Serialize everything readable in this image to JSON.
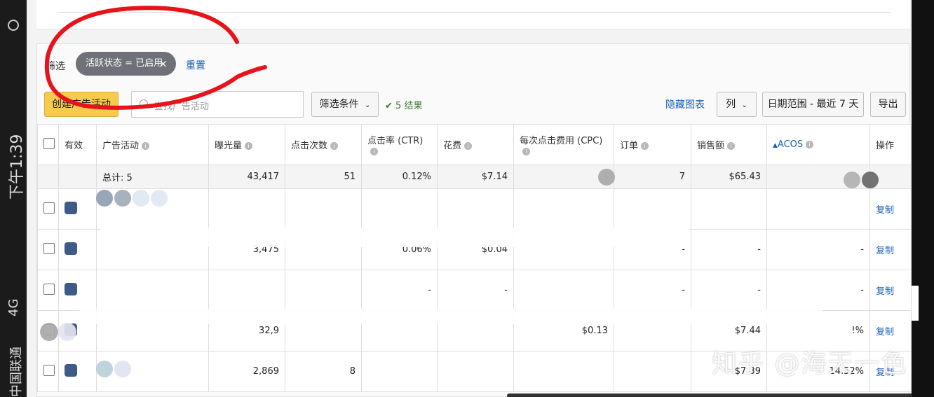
{
  "status_bar": {
    "time": "下午1:39",
    "network": "4G",
    "carrier": "中国联通"
  },
  "filter": {
    "label": "筛选",
    "chip": "活跃状态 = 已启用",
    "chip_close": "×",
    "reset": "重置"
  },
  "toolbar": {
    "create": "创建广告活动",
    "search_placeholder": "查找广告活动",
    "filter_conditions": "筛选条件",
    "results": "5 结果",
    "hide_chart": "隐藏图表",
    "columns": "列",
    "date_range": "日期范围 - 最近 7 天",
    "export": "导出"
  },
  "table": {
    "headers": [
      "有效",
      "广告活动",
      "曝光量",
      "点击次数",
      "点击率 (CTR)",
      "花费",
      "每次点击费用 (CPC)",
      "订单",
      "销售额",
      "ACOS",
      "操作"
    ],
    "total": {
      "label": "总计: 5",
      "impressions": "43,417",
      "clicks": "51",
      "ctr": "0.12%",
      "spend": "$7.14",
      "orders": "7",
      "sales": "$65.43"
    },
    "rows": [
      {
        "impressions": "",
        "clicks": "",
        "ctr": "",
        "spend": "",
        "cpc": "",
        "orders": "",
        "sales": "",
        "acos": "",
        "action": "复制"
      },
      {
        "impressions": "3,475",
        "clicks": "",
        "ctr": "0.06%",
        "spend": "$0.04",
        "cpc": "",
        "orders": "-",
        "sales": "-",
        "acos": "-",
        "action": "复制"
      },
      {
        "impressions": "",
        "clicks": "",
        "ctr": "-",
        "spend": "-",
        "cpc": "",
        "orders": "-",
        "sales": "-",
        "acos": "-",
        "action": "复制"
      },
      {
        "impressions": "32,9",
        "clicks": "",
        "ctr": "",
        "spend": "",
        "cpc": "$0.13",
        "orders": "",
        "sales": "$7.44",
        "acos": "!%",
        "action": "复制"
      },
      {
        "impressions": "2,869",
        "clicks": "8",
        "ctr": "",
        "spend": "",
        "cpc": "",
        "orders": "",
        "sales": "$7.39",
        "acos": "14.52%",
        "action": "复制"
      }
    ]
  },
  "watermark": "知乎 @海天一色",
  "colors": {
    "accent_link": "#1a5fb4",
    "create_button": "#f7ca4d",
    "annotation": "#e8121a",
    "results_check": "#3a7a2e"
  }
}
